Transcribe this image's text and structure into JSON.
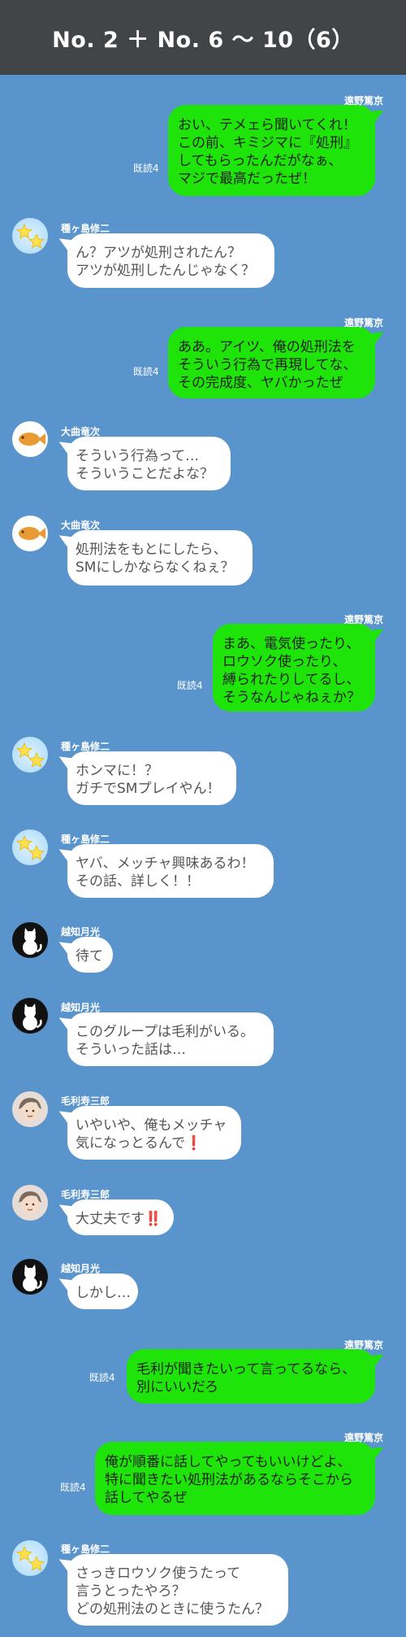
{
  "header": {
    "title": "No. 2 ＋ No. 6 〜 10（6）"
  },
  "read_label": "既読4",
  "messages": [
    {
      "kind": "sent",
      "name": "遠野篤京",
      "text": "おい、テメェら聞いてくれ！\nこの前、キミジマに『処刑』\nしてもらったんだがなぁ、\nマジで最高だったぜ！",
      "read": "既読4"
    },
    {
      "kind": "recv",
      "name": "種ヶ島修二",
      "avatar": "star-avatar-icon",
      "text": "ん？アツが処刑されたん？\nアツが処刑したんじゃなく？"
    },
    {
      "kind": "sent",
      "name": "遠野篤京",
      "text": "ああ。アイツ、俺の処刑法を\nそういう行為で再現してな、\nその完成度、ヤバかったぜ",
      "read": "既読4"
    },
    {
      "kind": "recv",
      "name": "大曲竜次",
      "avatar": "taiyaki-avatar-icon",
      "text": "そういう行為って…\nそういうことだよな？"
    },
    {
      "kind": "recv",
      "name": "大曲竜次",
      "avatar": "taiyaki-avatar-icon",
      "text": "処刑法をもとにしたら、\nSMにしかならなくねぇ？"
    },
    {
      "kind": "sent",
      "name": "遠野篤京",
      "text": "まあ、電気使ったり、\nロウソク使ったり、\n縛られたりしてるし、\nそうなんじゃねぇか？",
      "read": "既読4"
    },
    {
      "kind": "recv",
      "name": "種ヶ島修二",
      "avatar": "star-avatar-icon",
      "text": "ホンマに！？\nガチでSMプレイやん！"
    },
    {
      "kind": "recv",
      "name": "種ヶ島修二",
      "avatar": "star-avatar-icon",
      "text": "ヤバ、メッチャ興味あるわ！\nその話、詳しく！！"
    },
    {
      "kind": "recv",
      "name": "越知月光",
      "avatar": "cat-avatar-icon",
      "text": "待て"
    },
    {
      "kind": "recv",
      "name": "越知月光",
      "avatar": "cat-avatar-icon",
      "text": "このグループは毛利がいる。\nそういった話は…"
    },
    {
      "kind": "recv",
      "name": "毛利寿三郎",
      "avatar": "boy-avatar-icon",
      "text": "いやいや、俺もメッチャ\n気になっとるんで❗"
    },
    {
      "kind": "recv",
      "name": "毛利寿三郎",
      "avatar": "boy-avatar-icon",
      "text": "大丈夫です‼️"
    },
    {
      "kind": "recv",
      "name": "越知月光",
      "avatar": "cat-avatar-icon",
      "text": "しかし…"
    },
    {
      "kind": "sent",
      "name": "遠野篤京",
      "text": "毛利が聞きたいって言ってるなら、\n別にいいだろ",
      "read": "既読4"
    },
    {
      "kind": "sent",
      "name": "遠野篤京",
      "text": "俺が順番に話してやってもいいけどよ、\n特に聞きたい処刑法があるならそこから\n話してやるぜ",
      "read": "既読4"
    },
    {
      "kind": "recv",
      "name": "種ヶ島修二",
      "avatar": "star-avatar-icon",
      "text": "さっきロウソク使うたって\n言うとったやろ？\nどの処刑法のときに使うたん？"
    }
  ]
}
